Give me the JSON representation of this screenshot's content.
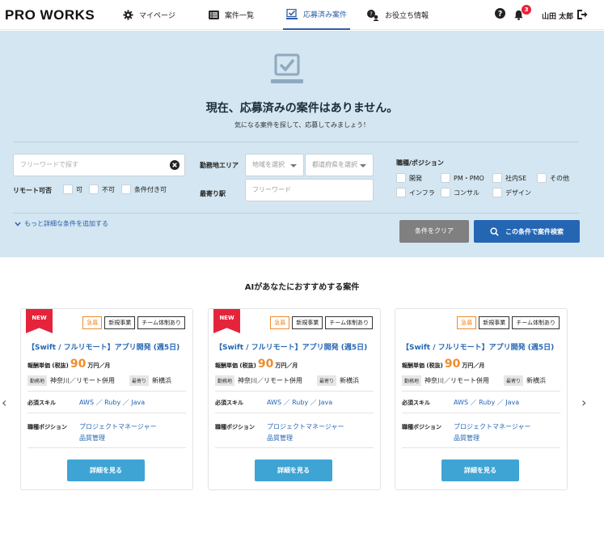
{
  "header": {
    "logo": "PRO WORKS",
    "nav": [
      {
        "label": "マイページ",
        "icon": "gear-icon"
      },
      {
        "label": "案件一覧",
        "icon": "list-icon"
      },
      {
        "label": "応募済み案件",
        "icon": "applied-check-icon",
        "active": true
      },
      {
        "label": "お役立ち情報",
        "icon": "info-people-icon"
      }
    ],
    "notification_count": "3",
    "user_name": "山田 太郎"
  },
  "empty_state": {
    "title": "現在、応募済みの案件はありません。",
    "subtitle": "気になる案件を探して、応募してみましょう！"
  },
  "search": {
    "free_word_placeholder": "フリーワードで探す",
    "remote_label": "リモート可否",
    "remote_options": [
      "可",
      "不可",
      "条件付き可"
    ],
    "area_label": "勤務地エリア",
    "region_placeholder": "地域を選択",
    "pref_placeholder": "都道府県を選択",
    "station_label": "最寄り駅",
    "station_placeholder": "フリーワード",
    "position_label": "職種/ポジション",
    "positions": [
      "開発",
      "PM・PMO",
      "社内SE",
      "その他",
      "インフラ",
      "コンサル",
      "デザイン"
    ],
    "more_conditions": "もっと詳細な条件を追加する",
    "clear_button": "条件をクリア",
    "search_button": "この条件で案件検索"
  },
  "recommend": {
    "title": "AIがあなたにおすすめする案件",
    "cards": [
      {
        "badge": "NEW",
        "tags": [
          "急募",
          "新規事業",
          "チーム体制あり"
        ],
        "title": "【Swift / フルリモート】アプリ開発 (週5日)",
        "pay_label": "報酬単価 (税抜)",
        "pay_value": "90",
        "pay_unit": "万円／月",
        "location_tag": "勤務地",
        "location": "神奈川／リモート併用",
        "station_tag": "最寄り",
        "station": "新横浜",
        "skill_label": "必須スキル",
        "skills": "AWS ／ Ruby ／ Java",
        "position_label": "職種ポジション",
        "position_1": "プロジェクトマネージャー",
        "position_2": "品質管理",
        "detail_button": "詳細を見る"
      },
      {
        "badge": "NEW",
        "tags": [
          "急募",
          "新規事業",
          "チーム体制あり"
        ],
        "title": "【Swift / フルリモート】アプリ開発 (週5日)",
        "pay_label": "報酬単価 (税抜)",
        "pay_value": "90",
        "pay_unit": "万円／月",
        "location_tag": "勤務地",
        "location": "神奈川／リモート併用",
        "station_tag": "最寄り",
        "station": "新横浜",
        "skill_label": "必須スキル",
        "skills": "AWS ／ Ruby ／ Java",
        "position_label": "職種ポジション",
        "position_1": "プロジェクトマネージャー",
        "position_2": "品質管理",
        "detail_button": "詳細を見る"
      },
      {
        "badge": "",
        "tags": [
          "急募",
          "新規事業",
          "チーム体制あり"
        ],
        "title": "【Swift / フルリモート】アプリ開発 (週5日)",
        "pay_label": "報酬単価 (税抜)",
        "pay_value": "90",
        "pay_unit": "万円／月",
        "location_tag": "勤務地",
        "location": "神奈川／リモート併用",
        "station_tag": "最寄り",
        "station": "新横浜",
        "skill_label": "必須スキル",
        "skills": "AWS ／ Ruby ／ Java",
        "position_label": "職種ポジション",
        "position_1": "プロジェクトマネージャー",
        "position_2": "品質管理",
        "detail_button": "詳細を見る"
      }
    ]
  },
  "colors": {
    "accent": "#2566b3",
    "band": "#d3e6f1",
    "urgent": "#f08c2a",
    "new": "#e5243b",
    "detail": "#3ea4d4"
  }
}
